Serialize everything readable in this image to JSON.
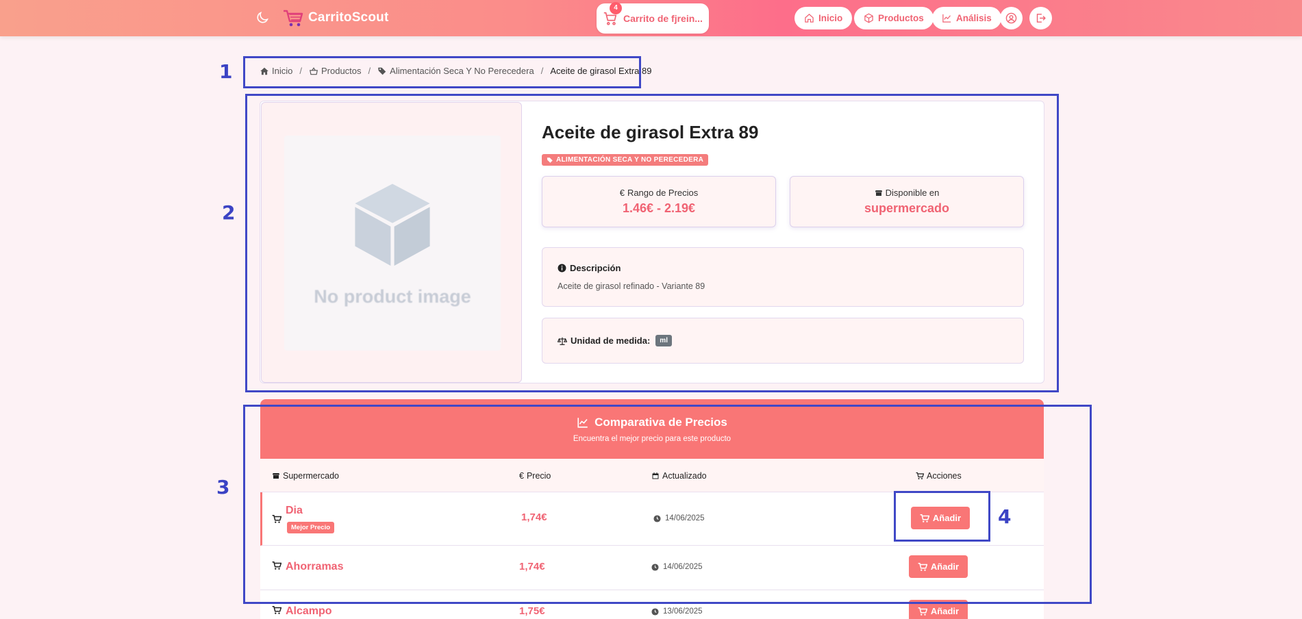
{
  "navbar": {
    "brand": "CarritoScout",
    "cart_label": "Carrito de fjrein...",
    "cart_count": "4",
    "links": [
      {
        "label": "Inicio",
        "icon": "home-icon"
      },
      {
        "label": "Productos",
        "icon": "box-icon"
      },
      {
        "label": "Análisis",
        "icon": "chart-line-icon"
      }
    ],
    "colors": {
      "accent": "#f06373",
      "gradient_start": "#f9a08c",
      "gradient_mid": "#fd6e8a"
    }
  },
  "breadcrumb": {
    "home": "Inicio",
    "products": "Productos",
    "category": "Alimentación Seca Y No Perecedera",
    "current": "Aceite de girasol Extra 89"
  },
  "product": {
    "no_image_text": "No product image",
    "title": "Aceite de girasol Extra 89",
    "category_badge": "ALIMENTACIÓN SECA Y NO PERECEDERA",
    "price_range_label": "Rango de Precios",
    "price_range_value": "1.46€ - 2.19€",
    "available_label": "Disponible en",
    "available_value": "supermercado",
    "description_title": "Descripción",
    "description_text": "Aceite de girasol refinado - Variante 89",
    "unit_label": "Unidad de medida:",
    "unit_value": "ml"
  },
  "comparison": {
    "title": "Comparativa de Precios",
    "subtitle": "Encuentra el mejor precio para este producto",
    "headers": {
      "store": "Supermercado",
      "price": "Precio",
      "updated": "Actualizado",
      "actions": "Acciones"
    },
    "rows": [
      {
        "store": "Dia",
        "badge": "Mejor Precio",
        "price": "1,74€",
        "date": "14/06/2025",
        "action": "Añadir"
      },
      {
        "store": "Ahorramas",
        "price": "1,74€",
        "date": "14/06/2025",
        "action": "Añadir"
      },
      {
        "store": "Alcampo",
        "price": "1,75€",
        "date": "13/06/2025",
        "action": "Añadir"
      }
    ]
  },
  "annotations": [
    "1",
    "2",
    "3",
    "4"
  ]
}
